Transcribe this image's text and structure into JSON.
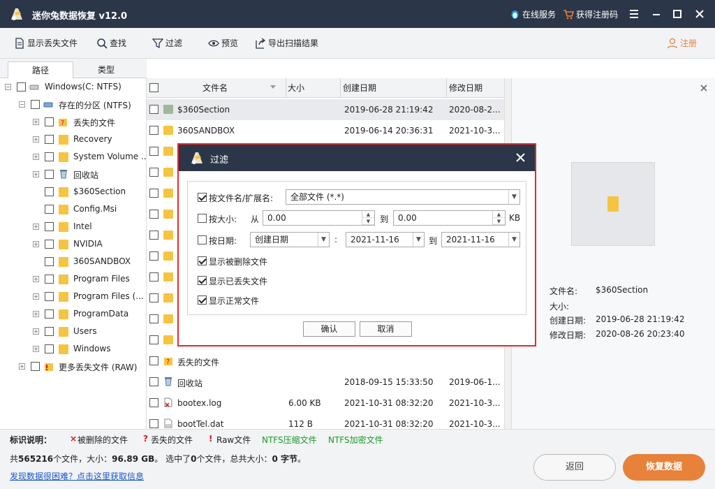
{
  "app": {
    "title": "迷你兔数据恢复 v12.0",
    "online_service": "在线服务",
    "get_code": "获得注册码"
  },
  "toolbar": {
    "show_lost": "显示丢失文件",
    "find": "查找",
    "filter": "过滤",
    "preview": "预览",
    "export": "导出扫描结果",
    "register": "注册"
  },
  "tabs": {
    "path": "路径",
    "type": "类型"
  },
  "tree": {
    "drive": "Windows(C: NTFS)",
    "partition": "存在的分区 (NTFS)",
    "items": [
      "丢失的文件",
      "Recovery",
      "System Volume ...",
      "回收站",
      "$360Section",
      "Config.Msi",
      "Intel",
      "NVIDIA",
      "360SANDBOX",
      "Program Files",
      "Program Files (...",
      "ProgramData",
      "Users",
      "Windows"
    ],
    "raw": "更多丢失文件 (RAW)"
  },
  "filelist": {
    "headers": {
      "name": "文件名",
      "size": "大小",
      "created": "创建日期",
      "modified": "修改日期"
    },
    "rows": [
      {
        "name": "$360Section",
        "size": "",
        "created": "2019-06-28 21:19:42",
        "modified": "2020-08-2..."
      },
      {
        "name": "360SANDBOX",
        "size": "",
        "created": "2019-06-14 20:36:31",
        "modified": "2021-10-3..."
      }
    ],
    "bottom_rows": [
      {
        "name": "丢失的文件",
        "size": "",
        "created": "",
        "modified": ""
      },
      {
        "name": "回收站",
        "size": "",
        "created": "2018-09-15 15:33:50",
        "modified": "2019-06-1..."
      },
      {
        "name": "bootex.log",
        "size": "6.00 KB",
        "created": "2021-10-31 08:32:20",
        "modified": "2021-10-3..."
      },
      {
        "name": "bootTel.dat",
        "size": "112 B",
        "created": "2021-10-31 08:32:20",
        "modified": "2021-10-3..."
      }
    ]
  },
  "preview": {
    "name_label": "文件名:",
    "name": "$360Section",
    "size_label": "大小:",
    "created_label": "创建日期:",
    "created": "2019-06-28 21:19:42",
    "modified_label": "修改日期:",
    "modified": "2020-08-26 20:23:40"
  },
  "legend": {
    "title": "标识说明：",
    "deleted": "被删除的文件",
    "lost": "丢失的文件",
    "raw": "Raw文件",
    "ntfs_compressed": "NTFS压缩文件",
    "ntfs_encrypted": "NTFS加密文件"
  },
  "status": {
    "p1": "共",
    "count": "565216",
    "p2": "个文件，大小：",
    "size": "96.89 GB",
    "p3": "。 选中了",
    "sel": "0",
    "p4": "个文件，总共大小：",
    "sel_size": "0 字节",
    "p5": "。"
  },
  "help_link": "发现数据很困难？点击这里获取信息",
  "buttons": {
    "back": "返回",
    "recover": "恢复数据"
  },
  "dialog": {
    "title": "过滤",
    "by_name_label": "按文件名/扩展名:",
    "name_value": "全部文件 (*.*)",
    "by_size_label": "按大小:",
    "from": "从",
    "size_from": "0.00",
    "to": "到",
    "size_to": "0.00",
    "unit": "KB",
    "by_date_label": "按日期:",
    "date_type": "创建日期",
    "colon": ":",
    "date_from": "2021-11-16",
    "date_to": "2021-11-16",
    "show_deleted": "显示被删除文件",
    "show_lost": "显示已丢失文件",
    "show_normal": "显示正常文件",
    "ok": "确认",
    "cancel": "取消"
  },
  "colors": {
    "titlebar": "#2c3649",
    "accent": "#e8813a",
    "dialog_border": "#e02b2b",
    "link": "#1a56c7"
  }
}
